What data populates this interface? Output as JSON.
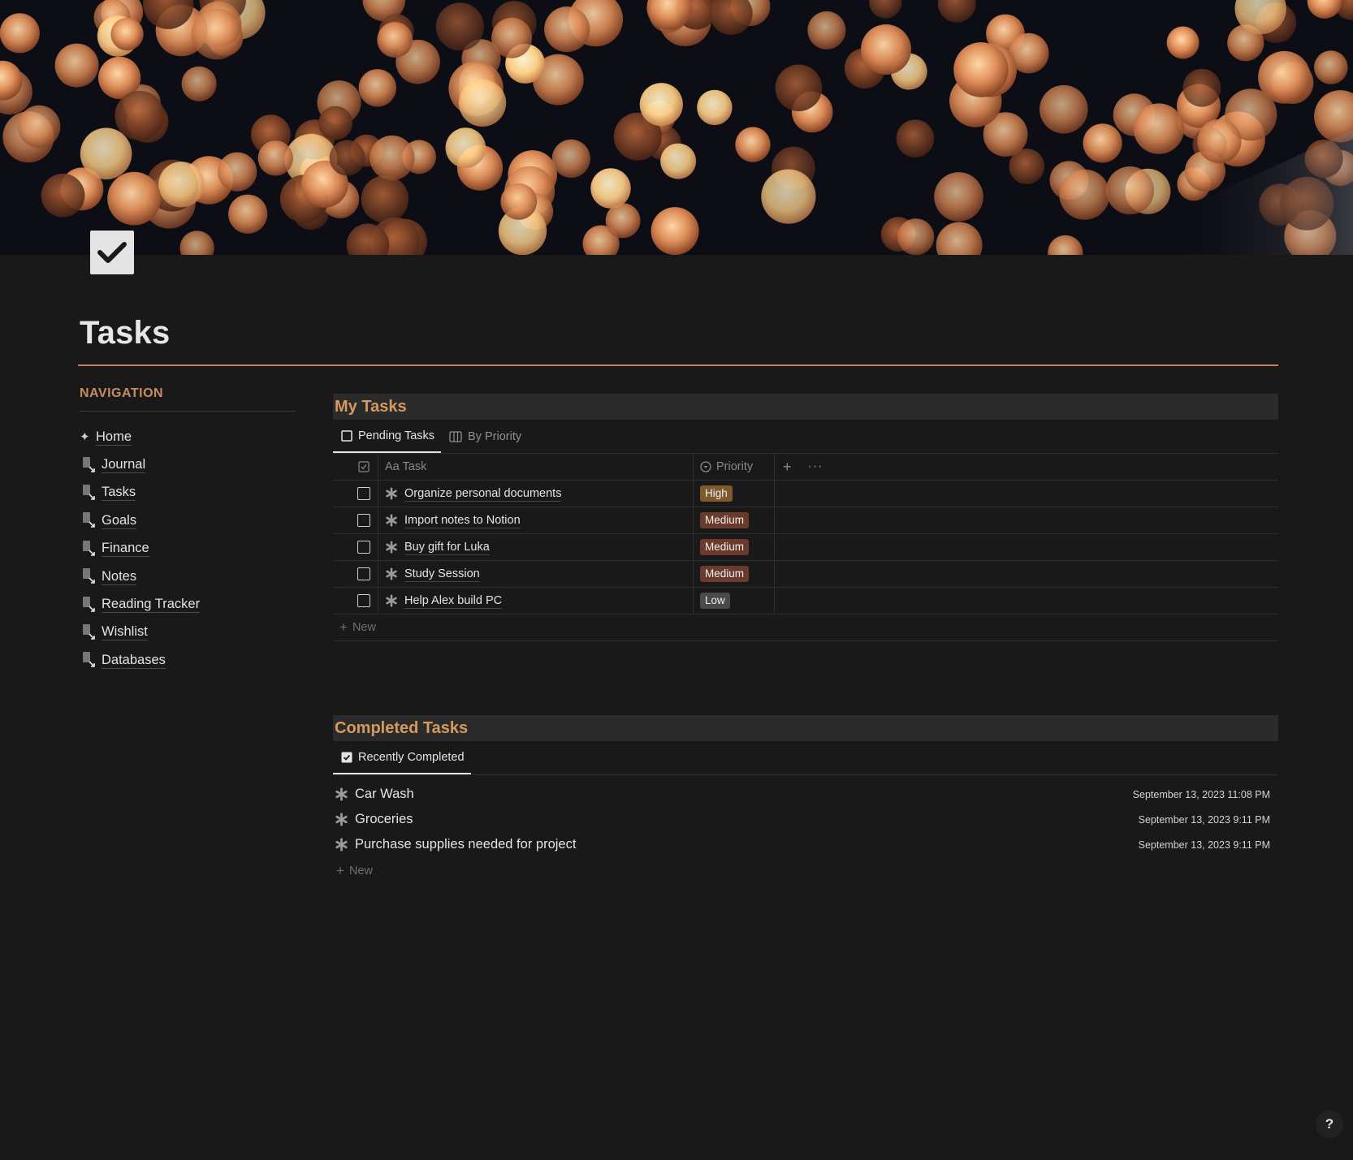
{
  "page": {
    "title": "Tasks"
  },
  "navigation": {
    "heading": "NAVIGATION",
    "items": [
      {
        "label": "Home",
        "icon": "sparkle-icon"
      },
      {
        "label": "Journal",
        "icon": "journal-link-icon"
      },
      {
        "label": "Tasks",
        "icon": "tasks-link-icon"
      },
      {
        "label": "Goals",
        "icon": "goals-link-icon"
      },
      {
        "label": "Finance",
        "icon": "finance-link-icon"
      },
      {
        "label": "Notes",
        "icon": "notes-link-icon"
      },
      {
        "label": "Reading Tracker",
        "icon": "reading-link-icon"
      },
      {
        "label": "Wishlist",
        "icon": "wishlist-link-icon"
      },
      {
        "label": "Databases",
        "icon": "databases-link-icon"
      }
    ]
  },
  "my_tasks": {
    "title": "My Tasks",
    "tabs": [
      {
        "label": "Pending Tasks",
        "active": true
      },
      {
        "label": "By Priority",
        "active": false
      }
    ],
    "columns": {
      "task": "Aa Task",
      "priority": "Priority"
    },
    "rows": [
      {
        "task": "Organize personal documents",
        "priority": "High",
        "color": "#7d5a2c"
      },
      {
        "task": "Import notes to Notion",
        "priority": "Medium",
        "color": "#6a3b2c"
      },
      {
        "task": "Buy gift for Luka",
        "priority": "Medium",
        "color": "#6a3b2c"
      },
      {
        "task": "Study Session",
        "priority": "Medium",
        "color": "#6a3b2c"
      },
      {
        "task": "Help Alex build PC",
        "priority": "Low",
        "color": "#4a4a4a"
      }
    ],
    "new_label": "New"
  },
  "completed": {
    "title": "Completed Tasks",
    "tab": "Recently Completed",
    "items": [
      {
        "name": "Car Wash",
        "date": "September 13, 2023 11:08 PM"
      },
      {
        "name": "Groceries",
        "date": "September 13, 2023 9:11 PM"
      },
      {
        "name": "Purchase supplies needed for project",
        "date": "September 13, 2023 9:11 PM"
      }
    ],
    "new_label": "New"
  },
  "help": {
    "label": "?"
  },
  "colors": {
    "background": "#191919",
    "accent_orange": "#c77d5d",
    "section_title": "#d59a5d"
  }
}
